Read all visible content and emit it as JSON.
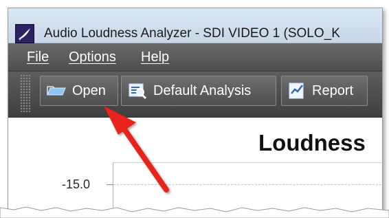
{
  "window": {
    "title": "Audio Loudness Analyzer - SDI VIDEO 1 (SOLO_K",
    "icon": "app-logo-icon"
  },
  "menu": {
    "items": [
      {
        "label": "File"
      },
      {
        "label": "Options"
      },
      {
        "label": "Help"
      }
    ]
  },
  "toolbar": {
    "buttons": [
      {
        "label": "Open",
        "icon": "folder-open-icon"
      },
      {
        "label": "Default Analysis",
        "icon": "analysis-icon"
      },
      {
        "label": "Report",
        "icon": "report-icon"
      }
    ]
  },
  "chart": {
    "title": "Loudness",
    "y_tick": "-15.0"
  },
  "annotation": {
    "arrow_color": "#e8231e"
  }
}
